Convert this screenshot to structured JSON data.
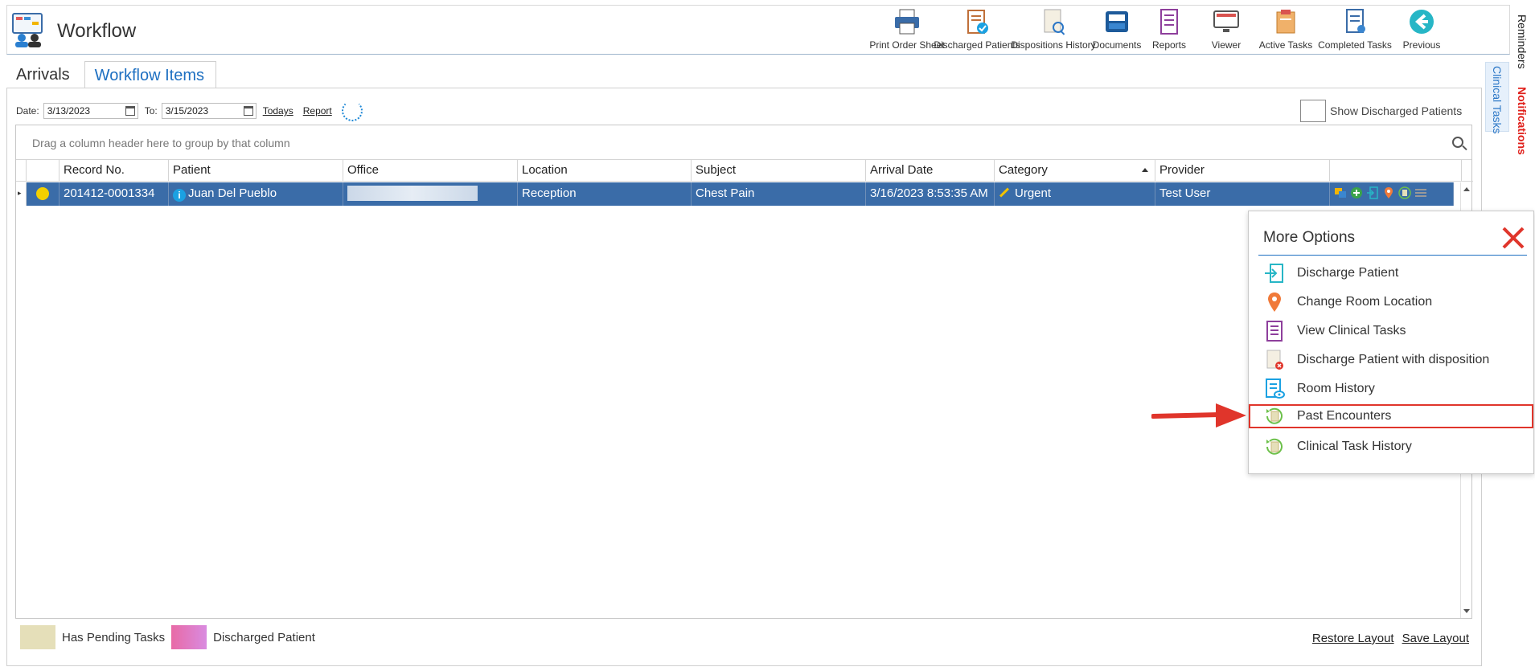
{
  "app": {
    "title": "Workflow"
  },
  "toolbar": [
    {
      "label": "Print Order Sheet",
      "icon": "printer-icon"
    },
    {
      "label": "Discharged Patients",
      "icon": "clipboard-check-icon"
    },
    {
      "label": "Dispositions History",
      "icon": "document-search-icon"
    },
    {
      "label": "Documents",
      "icon": "inbox-tray-icon"
    },
    {
      "label": "Reports",
      "icon": "report-list-icon"
    },
    {
      "label": "Viewer",
      "icon": "monitor-icon"
    },
    {
      "label": "Active Tasks",
      "icon": "task-box-icon"
    },
    {
      "label": "Completed Tasks",
      "icon": "completed-doc-icon"
    },
    {
      "label": "Previous",
      "icon": "back-arrow-icon"
    }
  ],
  "side_rail": {
    "reminders": "Reminders",
    "notifications": "Notifications",
    "clinical_tasks": "Clinical Tasks"
  },
  "tabs": [
    {
      "label": "Arrivals"
    },
    {
      "label": "Workflow Items"
    }
  ],
  "filters": {
    "date_label": "Date:",
    "date_from": "3/13/2023",
    "to_label": "To:",
    "date_to": "3/15/2023",
    "todays": "Todays",
    "report": "Report",
    "show_discharged": "Show Discharged Patients"
  },
  "grid": {
    "group_hint": "Drag a column header here to group by that column",
    "columns": [
      "Record No.",
      "Patient",
      "Office",
      "Location",
      "Subject",
      "Arrival Date",
      "Category",
      "Provider"
    ],
    "rows": [
      {
        "record_no": "201412-0001334",
        "patient": "Juan Del Pueblo",
        "location": "Reception",
        "subject": "Chest Pain",
        "arrival_date": "3/16/2023 8:53:35 AM",
        "category": "Urgent",
        "provider": "Test User"
      }
    ]
  },
  "popup": {
    "title": "More Options",
    "options": [
      {
        "label": "Discharge Patient",
        "icon": "discharge-icon"
      },
      {
        "label": "Change Room Location",
        "icon": "location-pin-icon"
      },
      {
        "label": "View Clinical Tasks",
        "icon": "clinical-tasks-icon"
      },
      {
        "label": "Discharge Patient with disposition",
        "icon": "disposition-doc-icon"
      },
      {
        "label": "Room History",
        "icon": "room-history-icon"
      },
      {
        "label": "Past Encounters",
        "icon": "past-encounters-icon"
      },
      {
        "label": "Clinical Task History",
        "icon": "task-history-icon"
      }
    ]
  },
  "legend": {
    "pending": "Has Pending Tasks",
    "discharged": "Discharged Patient"
  },
  "layout": {
    "restore": "Restore Layout",
    "save": "Save Layout"
  },
  "colors": {
    "accent": "#1d6fc1",
    "selected_row": "#3a6ca8",
    "highlight": "#e0352b"
  }
}
